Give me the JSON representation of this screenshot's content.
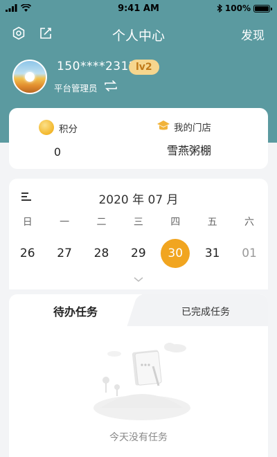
{
  "status_bar": {
    "time": "9:41 AM",
    "battery_text": "100%",
    "battery_level": 1.0
  },
  "nav": {
    "title": "个人中心",
    "discover": "发现"
  },
  "profile": {
    "phone": "150****2312",
    "level": "lv2",
    "role": "平台管理员"
  },
  "info": {
    "points_label": "积分",
    "points_value": "0",
    "store_label": "我的门店",
    "store_name": "雪燕粥棚"
  },
  "calendar": {
    "title": "2020 年 07 月",
    "weekdays": [
      "日",
      "一",
      "二",
      "三",
      "四",
      "五",
      "六"
    ],
    "days": [
      "26",
      "27",
      "28",
      "29",
      "30",
      "31",
      "01"
    ],
    "selected_day": "30"
  },
  "tasks": {
    "tab_pending": "待办任务",
    "tab_completed": "已完成任务",
    "empty_text": "今天没有任务"
  },
  "colors": {
    "header": "#5b9aa0",
    "accent": "#f1a520",
    "badge_bg": "#f6d68e"
  }
}
